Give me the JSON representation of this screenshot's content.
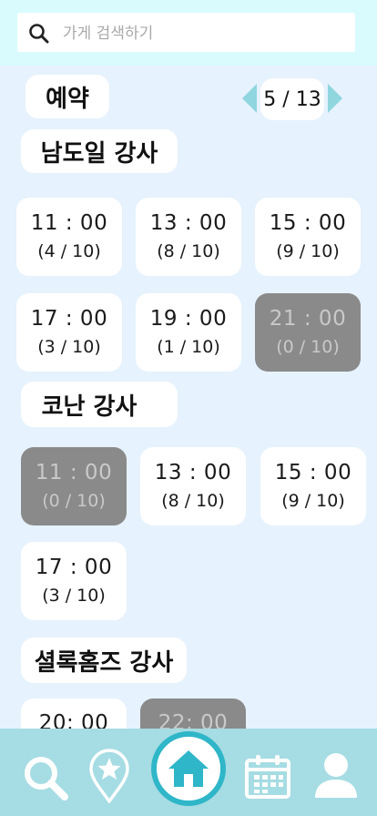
{
  "search": {
    "placeholder": "가게 검색하기",
    "value": ""
  },
  "page_title": "예약",
  "pager": {
    "label": "5 / 13"
  },
  "sections": [
    {
      "title": "남도일 강사",
      "slots": [
        {
          "time": "11 : 00",
          "count": "(4 / 10)",
          "available": true
        },
        {
          "time": "13 : 00",
          "count": "(8 / 10)",
          "available": true
        },
        {
          "time": "15 : 00",
          "count": "(9 / 10)",
          "available": true
        },
        {
          "time": "17 : 00",
          "count": "(3 / 10)",
          "available": true
        },
        {
          "time": "19 : 00",
          "count": "(1 / 10)",
          "available": true
        },
        {
          "time": "21 : 00",
          "count": "(0 / 10)",
          "available": false
        }
      ]
    },
    {
      "title": "코난 강사",
      "slots": [
        {
          "time": "11 : 00",
          "count": "(0 / 10)",
          "available": false
        },
        {
          "time": "13 : 00",
          "count": "(8 / 10)",
          "available": true
        },
        {
          "time": "15 : 00",
          "count": "(9 / 10)",
          "available": true
        },
        {
          "time": "17 : 00",
          "count": "(3 / 10)",
          "available": true
        }
      ]
    },
    {
      "title": "셜록홈즈 강사",
      "slots": [
        {
          "time": "20: 00",
          "count": "",
          "available": true
        },
        {
          "time": "22: 00",
          "count": "",
          "available": false
        }
      ]
    }
  ],
  "nav": [
    "search-icon",
    "favorite-pin-icon",
    "home-icon",
    "calendar-icon",
    "user-icon"
  ],
  "colors": {
    "background": "#e6f2fd",
    "top_band": "#d9fbfd",
    "nav_bar": "#a6dce3",
    "accent": "#2fb6c8",
    "arrow": "#8fd6df",
    "unavailable": "#8a8a8a"
  }
}
